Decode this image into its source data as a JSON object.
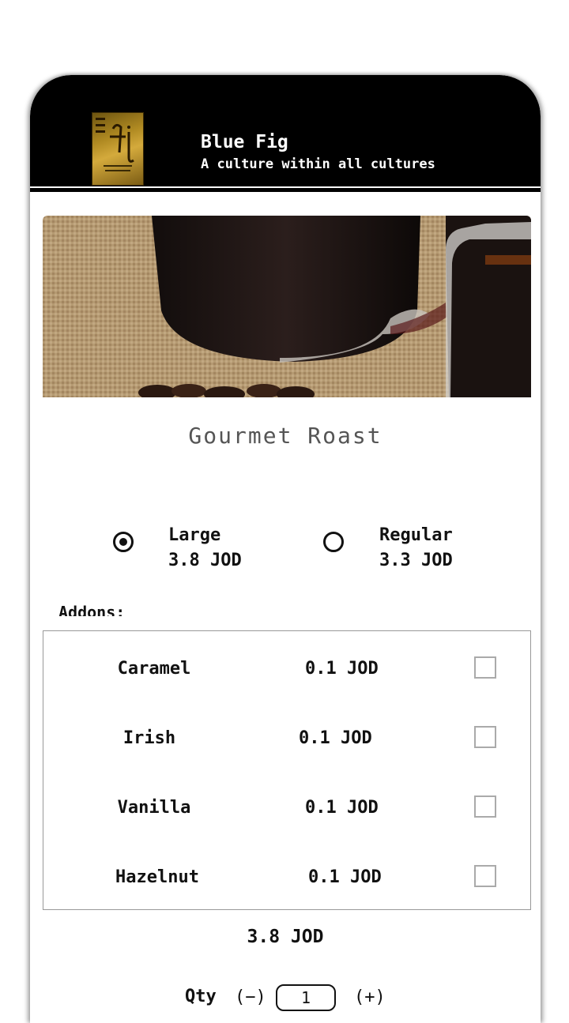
{
  "header": {
    "title": "Blue Fig",
    "tagline": "A culture within all cultures",
    "logo_icon": "blue-fig-logo"
  },
  "product": {
    "name": "Gourmet Roast",
    "image_icon": "coffee-cups-photo"
  },
  "sizes": [
    {
      "label": "Large",
      "price": "3.8 JOD",
      "selected": true
    },
    {
      "label": "Regular",
      "price": "3.3 JOD",
      "selected": false
    }
  ],
  "addons": {
    "label": "Addons:",
    "items": [
      {
        "name": "Caramel",
        "price": "0.1 JOD",
        "checked": false
      },
      {
        "name": "Irish",
        "price": "0.1 JOD",
        "checked": false
      },
      {
        "name": "Vanilla",
        "price": "0.1 JOD",
        "checked": false
      },
      {
        "name": "Hazelnut",
        "price": "0.1 JOD",
        "checked": false
      }
    ]
  },
  "total": "3.8 JOD",
  "quantity": {
    "label": "Qty",
    "value": "1",
    "decrement": "(−)",
    "increment": "(+)"
  },
  "colors": {
    "header_bg": "#000000",
    "text": "#111111",
    "border": "#999999"
  }
}
